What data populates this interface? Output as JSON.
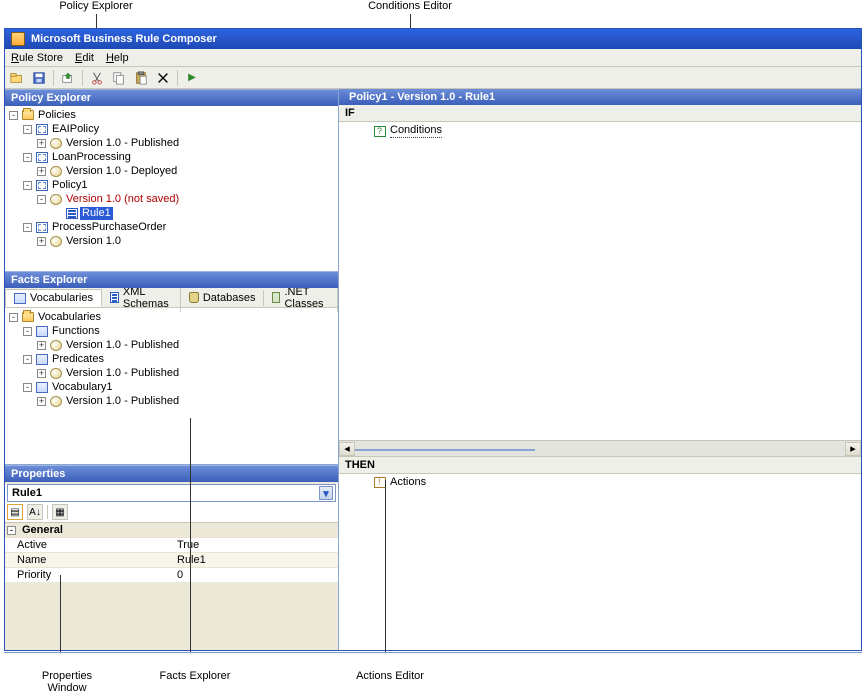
{
  "callouts": {
    "policy_explorer": "Policy Explorer",
    "conditions_editor": "Conditions Editor",
    "properties_window": "Properties\nWindow",
    "facts_explorer": "Facts Explorer",
    "actions_editor": "Actions Editor"
  },
  "window": {
    "title": "Microsoft Business Rule Composer"
  },
  "menu": {
    "rulestore": "Rule Store",
    "edit": "Edit",
    "help": "Help"
  },
  "policy_pane": {
    "title": "Policy Explorer",
    "tree": {
      "root": "Policies",
      "items": [
        {
          "name": "EAIPolicy",
          "version": "Version 1.0 - Published"
        },
        {
          "name": "LoanProcessing",
          "version": "Version 1.0 - Deployed"
        },
        {
          "name": "Policy1",
          "version": "Version 1.0 (not saved)",
          "rule": "Rule1"
        },
        {
          "name": "ProcessPurchaseOrder",
          "version": "Version 1.0"
        }
      ]
    }
  },
  "facts_pane": {
    "title": "Facts Explorer",
    "tabs": {
      "vocab": "Vocabularies",
      "xml": "XML Schemas",
      "db": "Databases",
      "net": ".NET Classes"
    },
    "tree": {
      "root": "Vocabularies",
      "items": [
        {
          "name": "Functions",
          "version": "Version 1.0 - Published"
        },
        {
          "name": "Predicates",
          "version": "Version 1.0 - Published"
        },
        {
          "name": "Vocabulary1",
          "version": "Version 1.0 - Published"
        }
      ]
    }
  },
  "props_pane": {
    "title": "Properties",
    "selector": "Rule1",
    "section": "General",
    "rows": [
      {
        "name": "Active",
        "value": "True"
      },
      {
        "name": "Name",
        "value": "Rule1"
      },
      {
        "name": "Priority",
        "value": "0"
      }
    ]
  },
  "editor": {
    "title": "Policy1 - Version 1.0 - Rule1",
    "if_kw": "IF",
    "conditions": "Conditions",
    "then_kw": "THEN",
    "actions": "Actions"
  }
}
